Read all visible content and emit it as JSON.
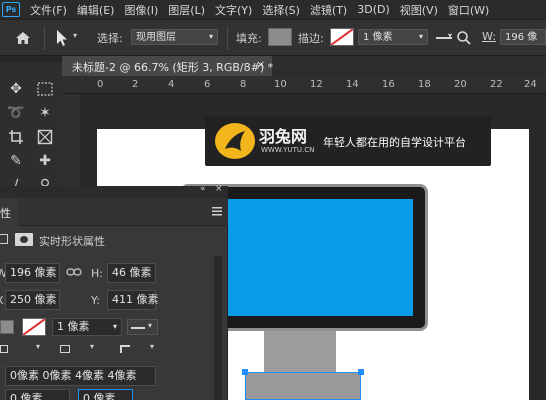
{
  "menubar": {
    "logo": "Ps",
    "items": [
      "文件(F)",
      "编辑(E)",
      "图像(I)",
      "图层(L)",
      "文字(Y)",
      "选择(S)",
      "滤镜(T)",
      "3D(D)",
      "视图(V)",
      "窗口(W)"
    ]
  },
  "options": {
    "select_label": "选择:",
    "select_value": "现用图层",
    "fill_label": "填充:",
    "stroke_label": "描边:",
    "stroke_width": "1 像素",
    "w_label": "W:",
    "w_value": "196 像"
  },
  "document": {
    "tab_title": "未标题-2 @ 66.7% (矩形 3, RGB/8#) *",
    "close": "×"
  },
  "ruler": {
    "ticks": [
      "0",
      "2",
      "4",
      "6",
      "8",
      "10",
      "12",
      "14",
      "16",
      "18",
      "20",
      "22",
      "24"
    ]
  },
  "banner": {
    "brand": "羽兔网",
    "url": "WWW.YUTU.CN",
    "slogan": "年轻人都在用的自学设计平台"
  },
  "properties": {
    "tab_label": "属性",
    "kind_label": "实时形状属性",
    "w_label": "W:",
    "w_value": "196 像素",
    "h_label": "H:",
    "h_value": "46 像素",
    "x_label": "X:",
    "x_value": "250 像素",
    "y_label": "Y:",
    "y_value": "411 像素",
    "stroke_width": "1 像素",
    "corner_radii": "0像素 0像素 4像素 4像素",
    "corner_a": "0 像素",
    "corner_b": "0 像素"
  },
  "colors": {
    "accent": "#31a8ff",
    "screen": "#0a9be8",
    "monitor_frame": "#1a1a1a",
    "stand": "#8c8c8c",
    "banner_bg": "#222222",
    "logo": "#f2b61c"
  }
}
